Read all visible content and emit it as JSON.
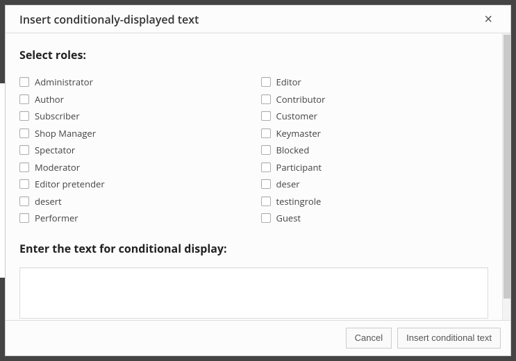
{
  "modal": {
    "title": "Insert conditionaly-displayed text",
    "close_label": "×"
  },
  "roles_heading": "Select roles:",
  "roles": {
    "left": [
      "Administrator",
      "Author",
      "Subscriber",
      "Shop Manager",
      "Spectator",
      "Moderator",
      "Editor pretender",
      "desert",
      "Performer"
    ],
    "right": [
      "Editor",
      "Contributor",
      "Customer",
      "Keymaster",
      "Blocked",
      "Participant",
      "deser",
      "testingrole",
      "Guest"
    ]
  },
  "textarea_heading": "Enter the text for conditional display:",
  "textarea_value": "",
  "footer": {
    "cancel": "Cancel",
    "insert": "Insert conditional text"
  }
}
